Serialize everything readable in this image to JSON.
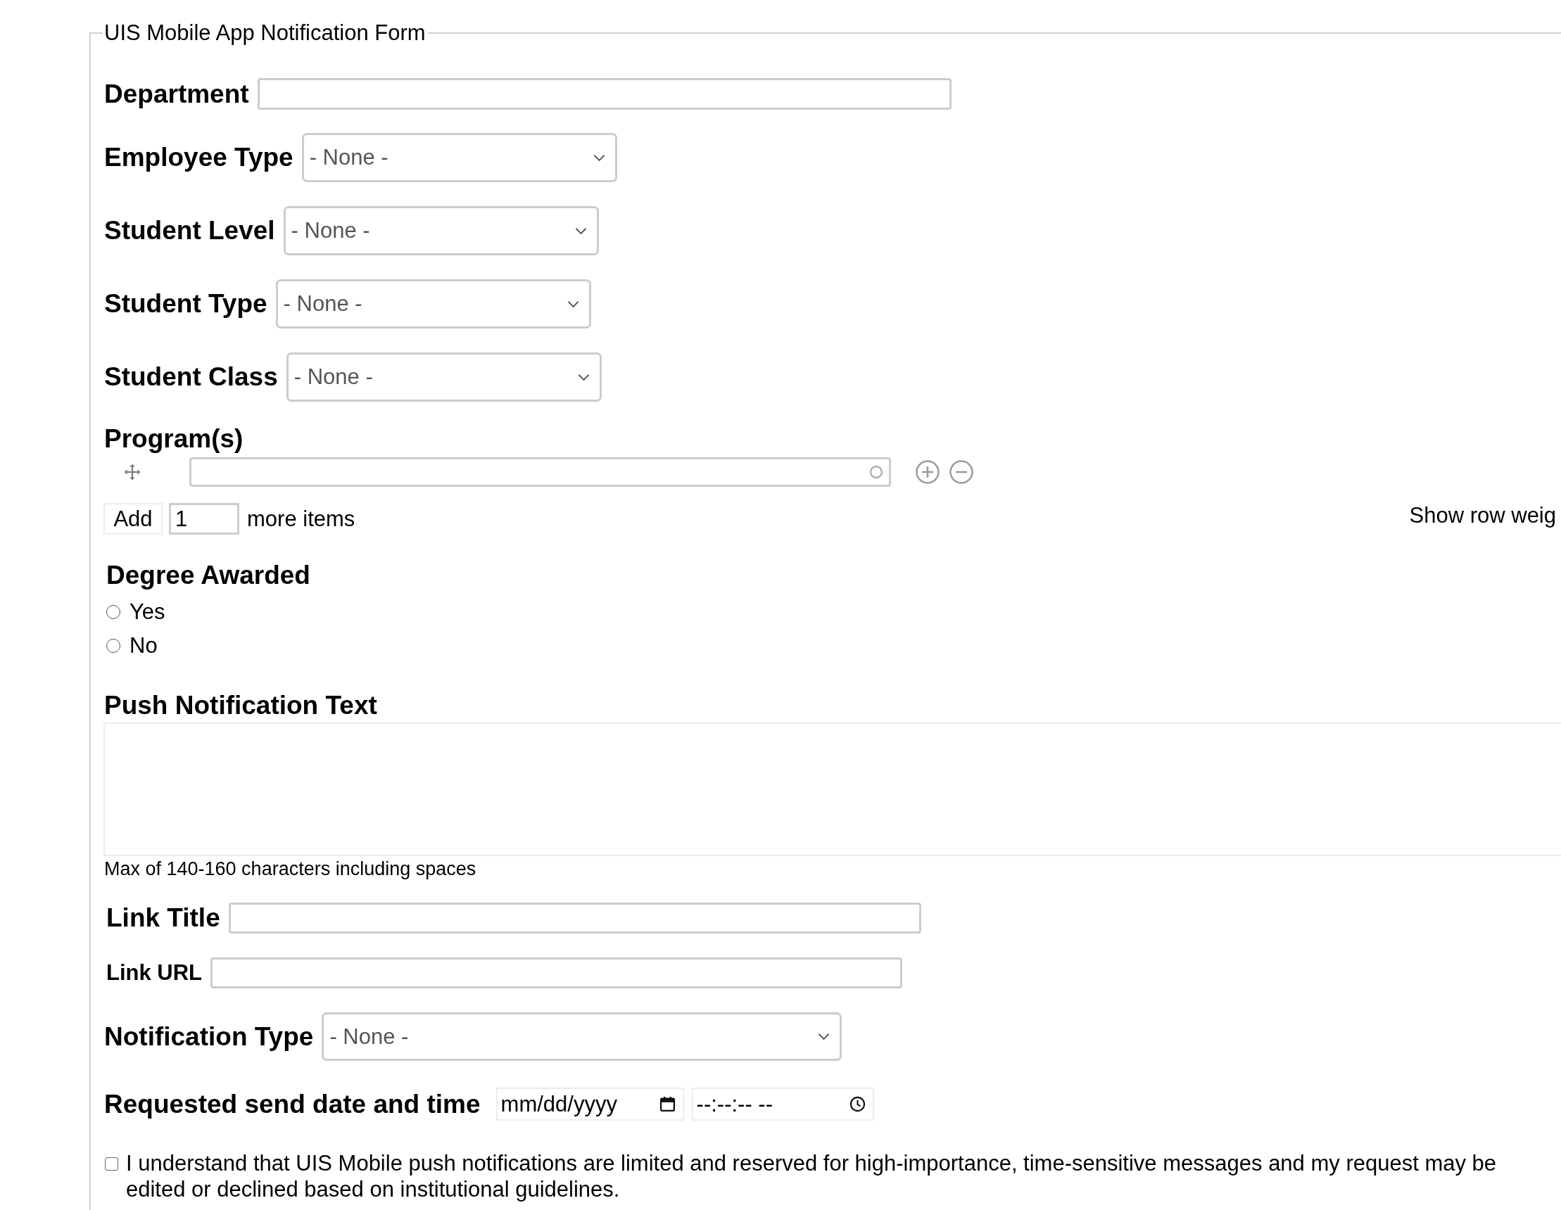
{
  "legend": "UIS Mobile App Notification Form",
  "department": {
    "label": "Department"
  },
  "selects": [
    {
      "label": "Employee Type",
      "value": "- None -"
    },
    {
      "label": "Student Level",
      "value": "- None -"
    },
    {
      "label": "Student Type",
      "value": "- None -"
    },
    {
      "label": "Student Class",
      "value": "- None -"
    }
  ],
  "programs": {
    "label": "Program(s)",
    "add_button": "Add",
    "add_count": "1",
    "add_suffix": "more items",
    "row_weights_toggle": "Show row weig"
  },
  "degree_awarded": {
    "label": "Degree Awarded",
    "options": [
      {
        "label": "Yes",
        "selected": false
      },
      {
        "label": "No",
        "selected": false
      }
    ]
  },
  "push_text": {
    "label": "Push Notification Text",
    "help": "Max of 140-160 characters including spaces"
  },
  "link_title": {
    "label": "Link Title"
  },
  "link_url": {
    "label": "Link URL"
  },
  "notification_type": {
    "label": "Notification Type",
    "value": "- None -"
  },
  "send_time": {
    "label": "Requested send date and time",
    "date_placeholder": "mm/dd/yyyy",
    "time_placeholder": "--:--:-- --"
  },
  "acknowledgement": {
    "checked": false,
    "text": "I understand that UIS Mobile push notifications are limited and reserved for high-importance, time-sensitive messages and my request may be edited or declined based on institutional guidelines."
  }
}
